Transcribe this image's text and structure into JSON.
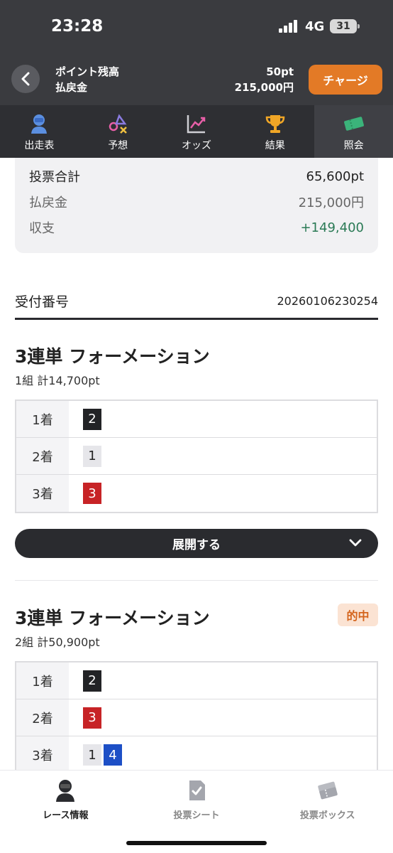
{
  "status": {
    "time": "23:28",
    "network": "4G",
    "battery": "31"
  },
  "header": {
    "points_label": "ポイント残高",
    "payout_label": "払戻金",
    "points_value": "50pt",
    "payout_value": "215,000円",
    "charge_label": "チャージ"
  },
  "tabs": [
    {
      "label": "出走表",
      "icon": "rider-icon"
    },
    {
      "label": "予想",
      "icon": "prediction-icon"
    },
    {
      "label": "オッズ",
      "icon": "odds-chart-icon"
    },
    {
      "label": "結果",
      "icon": "trophy-icon"
    },
    {
      "label": "照会",
      "icon": "ticket-icon",
      "active": true
    }
  ],
  "summary": {
    "total_label": "投票合計",
    "total_value": "65,600pt",
    "payout_label": "払戻金",
    "payout_value": "215,000円",
    "balance_label": "収支",
    "balance_value": "+149,400"
  },
  "receipt": {
    "label": "受付番号",
    "value": "20260106230254"
  },
  "bets": [
    {
      "title": "3連単 フォーメーション",
      "sub": "1組 計14,700pt",
      "rows": [
        {
          "label": "1着",
          "nums": [
            "2"
          ]
        },
        {
          "label": "2着",
          "nums": [
            "1"
          ]
        },
        {
          "label": "3着",
          "nums": [
            "3"
          ]
        }
      ],
      "expand_label": "展開する"
    },
    {
      "title": "3連単 フォーメーション",
      "sub": "2組 計50,900pt",
      "hit_badge": "的中",
      "rows": [
        {
          "label": "1着",
          "nums": [
            "2"
          ]
        },
        {
          "label": "2着",
          "nums": [
            "3"
          ]
        },
        {
          "label": "3着",
          "nums": [
            "1",
            "4"
          ]
        }
      ]
    }
  ],
  "bottom_nav": [
    {
      "label": "レース情報",
      "icon": "rider-icon",
      "active": true
    },
    {
      "label": "投票シート",
      "icon": "check-sheet-icon"
    },
    {
      "label": "投票ボックス",
      "icon": "tickets-icon"
    }
  ],
  "colors": {
    "accent": "#e37a26",
    "header_bg": "#3a3b3f",
    "positive": "#2a7a55",
    "num_black": "#222326",
    "num_white": "#e6e6ea",
    "num_red": "#c72326",
    "num_blue": "#1d4fc6"
  }
}
